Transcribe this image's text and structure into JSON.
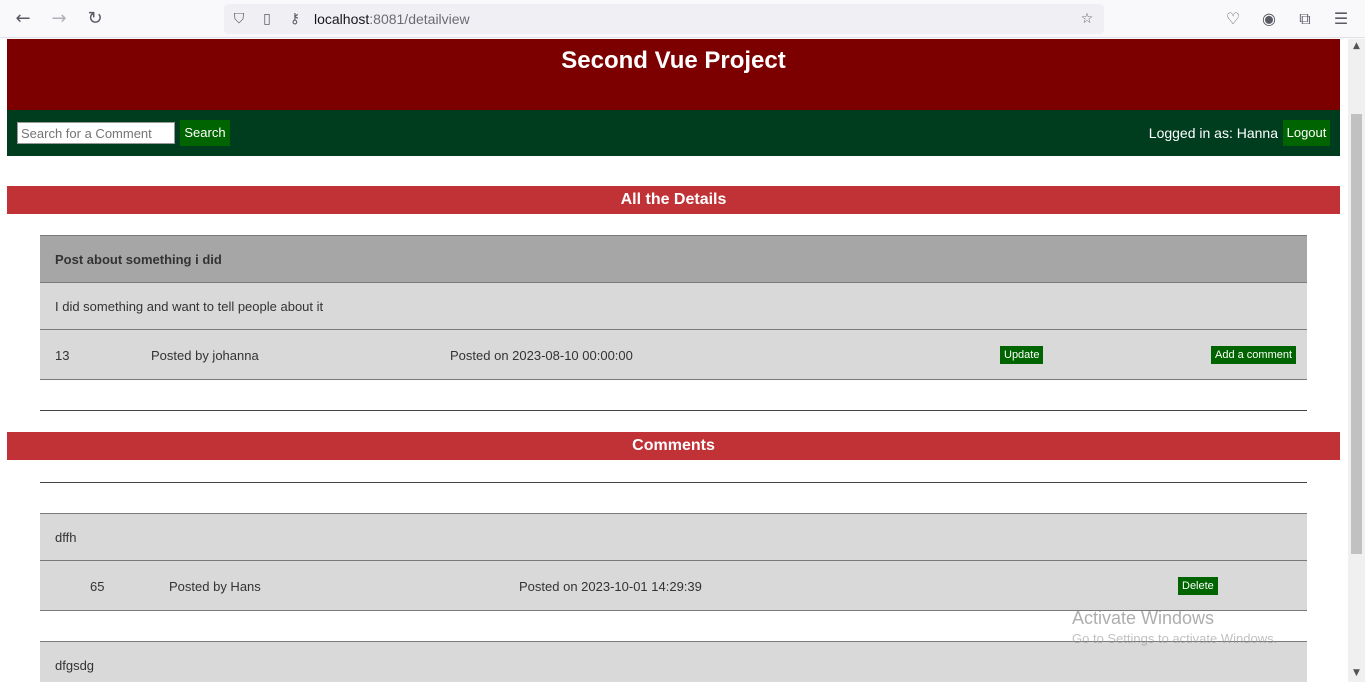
{
  "browser": {
    "url_host": "localhost",
    "url_rest": ":8081/detailview"
  },
  "header": {
    "title": "Second Vue Project"
  },
  "navbar": {
    "search_placeholder": "Search for a Comment",
    "search_label": "Search",
    "logged_in_text": "Logged in as: Hanna",
    "logout_label": "Logout"
  },
  "details": {
    "section_title": "All the Details",
    "post_title": "Post about something i did",
    "post_body": "I did something and want to tell people about it",
    "post_id": "13",
    "posted_by": "Posted by johanna",
    "posted_on": "Posted on 2023-08-10 00:00:00",
    "update_label": "Update",
    "add_comment_label": "Add a comment"
  },
  "comments": {
    "section_title": "Comments",
    "items": [
      {
        "text": "dffh",
        "id": "65",
        "posted_by": "Posted by Hans",
        "posted_on": "Posted on 2023-10-01 14:29:39",
        "delete_label": "Delete"
      },
      {
        "text": "dfgsdg"
      }
    ]
  },
  "watermark": {
    "line1": "Activate Windows",
    "line2": "Go to Settings to activate Windows."
  }
}
